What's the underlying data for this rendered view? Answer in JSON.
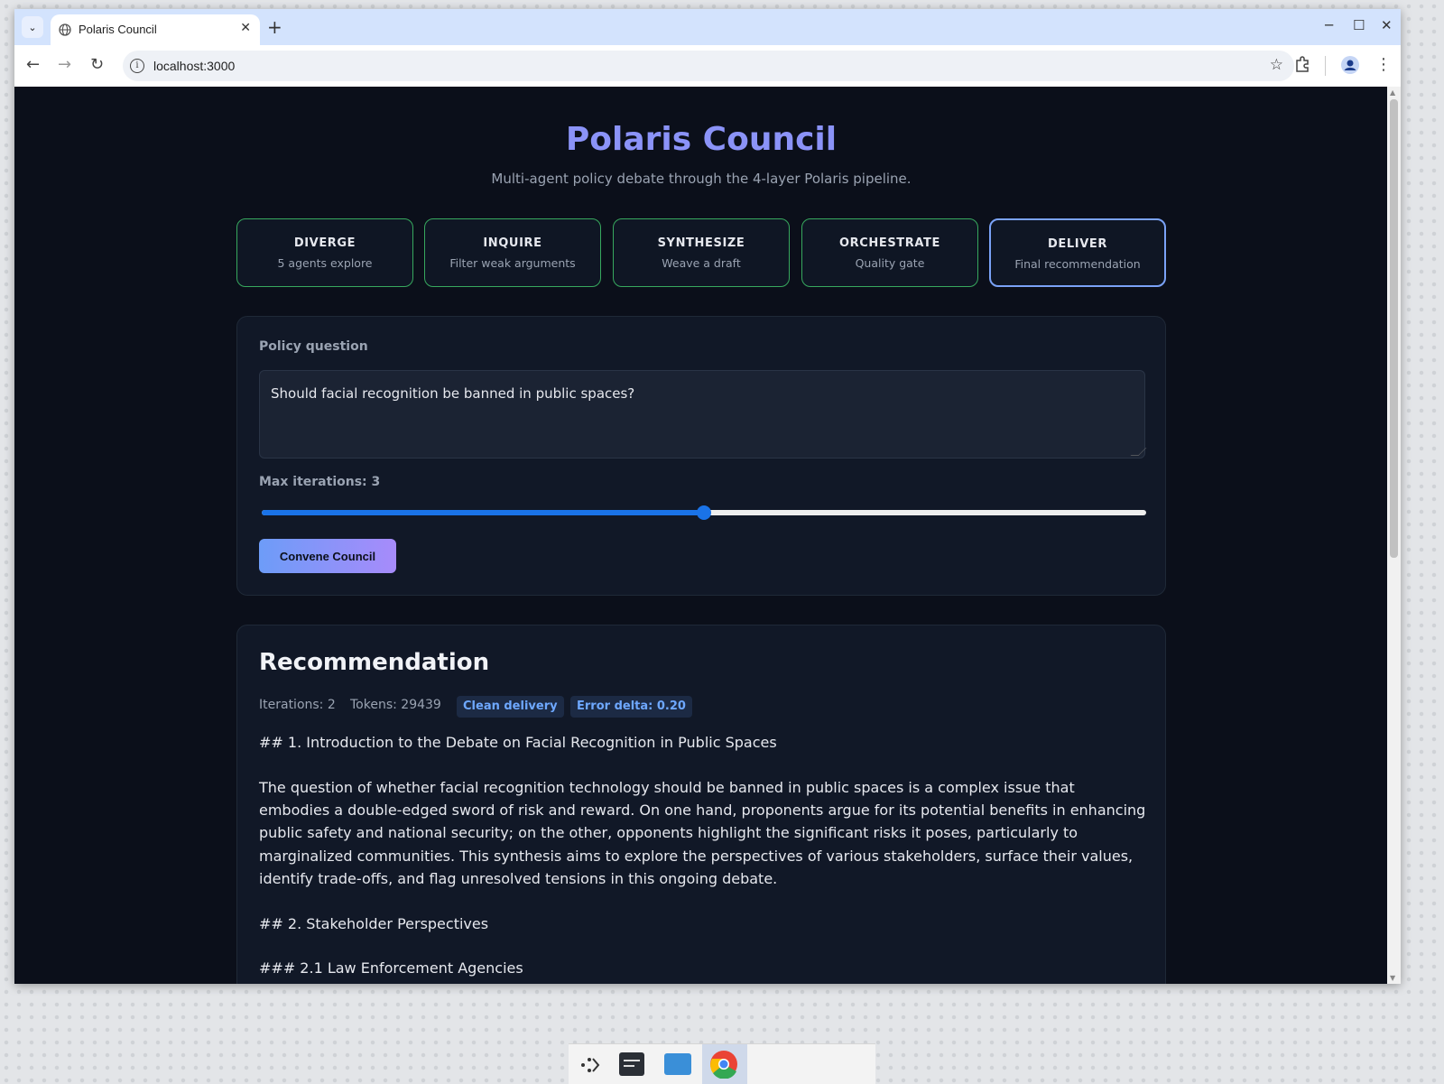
{
  "browser": {
    "tab_title": "Polaris Council",
    "url": "localhost:3000"
  },
  "header": {
    "title": "Polaris Council",
    "subtitle": "Multi-agent policy debate through the 4-layer Polaris pipeline."
  },
  "pipeline": [
    {
      "name": "DIVERGE",
      "desc": "5 agents explore",
      "active": false
    },
    {
      "name": "INQUIRE",
      "desc": "Filter weak arguments",
      "active": false
    },
    {
      "name": "SYNTHESIZE",
      "desc": "Weave a draft",
      "active": false
    },
    {
      "name": "ORCHESTRATE",
      "desc": "Quality gate",
      "active": false
    },
    {
      "name": "DELIVER",
      "desc": "Final recommendation",
      "active": true
    }
  ],
  "form": {
    "question_label": "Policy question",
    "question_value": "Should facial recognition be banned in public spaces?",
    "iterations_label": "Max iterations: 3",
    "iterations_value": 3,
    "iterations_fill_fraction": 0.5,
    "submit_label": "Convene Council"
  },
  "recommendation": {
    "title": "Recommendation",
    "iterations": "Iterations: 2",
    "tokens": "Tokens: 29439",
    "badge_clean": "Clean delivery",
    "badge_error": "Error delta: 0.20",
    "heading1": "## 1. Introduction to the Debate on Facial Recognition in Public Spaces",
    "paragraph1": "The question of whether facial recognition technology should be banned in public spaces is a complex issue that embodies a double-edged sword of risk and reward. On one hand, proponents argue for its potential benefits in enhancing public safety and national security; on the other, opponents highlight the significant risks it poses, particularly to marginalized communities. This synthesis aims to explore the perspectives of various stakeholders, surface their values, identify trade-offs, and flag unresolved tensions in this ongoing debate.",
    "heading2": "## 2. Stakeholder Perspectives",
    "heading3": "### 2.1 Law Enforcement Agencies"
  },
  "colors": {
    "accent": "#8b93f8",
    "stage_border": "#37a85e",
    "stage_active_border": "#7aa2f7",
    "badge_text": "#6ea8ff"
  }
}
